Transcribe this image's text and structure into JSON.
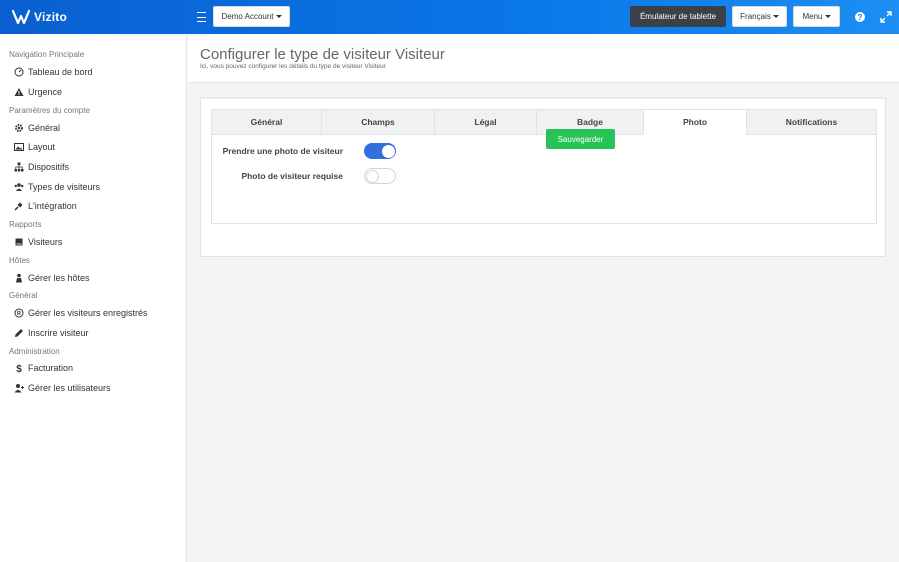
{
  "header": {
    "logo_text": "Vizito",
    "account_label": "Demo Account",
    "emulator_label": "Émulateur de tablette",
    "language_label": "Français",
    "menu_label": "Menu",
    "icons": [
      "hamburger-icon",
      "help-icon",
      "expand-icon"
    ]
  },
  "sidebar": {
    "sections": [
      {
        "title": "Navigation Principale",
        "items": [
          {
            "label": "Tableau de bord",
            "icon": "dashboard-icon"
          },
          {
            "label": "Urgence",
            "icon": "warning-icon"
          }
        ]
      },
      {
        "title": "Paramètres du compte",
        "items": [
          {
            "label": "Général",
            "icon": "gear-icon"
          },
          {
            "label": "Layout",
            "icon": "image-icon"
          },
          {
            "label": "Dispositifs",
            "icon": "sitemap-icon"
          },
          {
            "label": "Types de visiteurs",
            "icon": "users-icon"
          },
          {
            "label": "L'intégration",
            "icon": "plug-icon"
          }
        ]
      },
      {
        "title": "Rapports",
        "items": [
          {
            "label": "Visiteurs",
            "icon": "book-icon"
          }
        ]
      },
      {
        "title": "Hôtes",
        "items": [
          {
            "label": "Gérer les hôtes",
            "icon": "host-icon"
          }
        ]
      },
      {
        "title": "Général",
        "items": [
          {
            "label": "Gérer les visiteurs enregistrés",
            "icon": "registered-icon"
          },
          {
            "label": "Inscrire visiteur",
            "icon": "pencil-icon"
          }
        ]
      },
      {
        "title": "Administration",
        "items": [
          {
            "label": "Facturation",
            "icon": "dollar-icon"
          },
          {
            "label": "Gérer les utilisateurs",
            "icon": "user-plus-icon"
          }
        ]
      }
    ]
  },
  "page": {
    "title": "Configurer le type de visiteur Visiteur",
    "subtitle": "Ici, vous pouvez configurer les détails du type de visiteur Visiteur"
  },
  "tabs": [
    {
      "label": "Général",
      "active": false
    },
    {
      "label": "Champs",
      "active": false
    },
    {
      "label": "Légal",
      "active": false
    },
    {
      "label": "Badge",
      "active": false
    },
    {
      "label": "Photo",
      "active": true
    },
    {
      "label": "Notifications",
      "active": false
    }
  ],
  "form": {
    "take_photo_label": "Prendre une photo de visiteur",
    "take_photo_enabled": true,
    "photo_required_label": "Photo de visiteur requise",
    "photo_required_enabled": false
  },
  "save_label": "Sauvegarder",
  "colors": {
    "header": "#0a78e8",
    "primary": "#2f6fde",
    "success": "#28c356",
    "dark_button": "#3a4149"
  }
}
